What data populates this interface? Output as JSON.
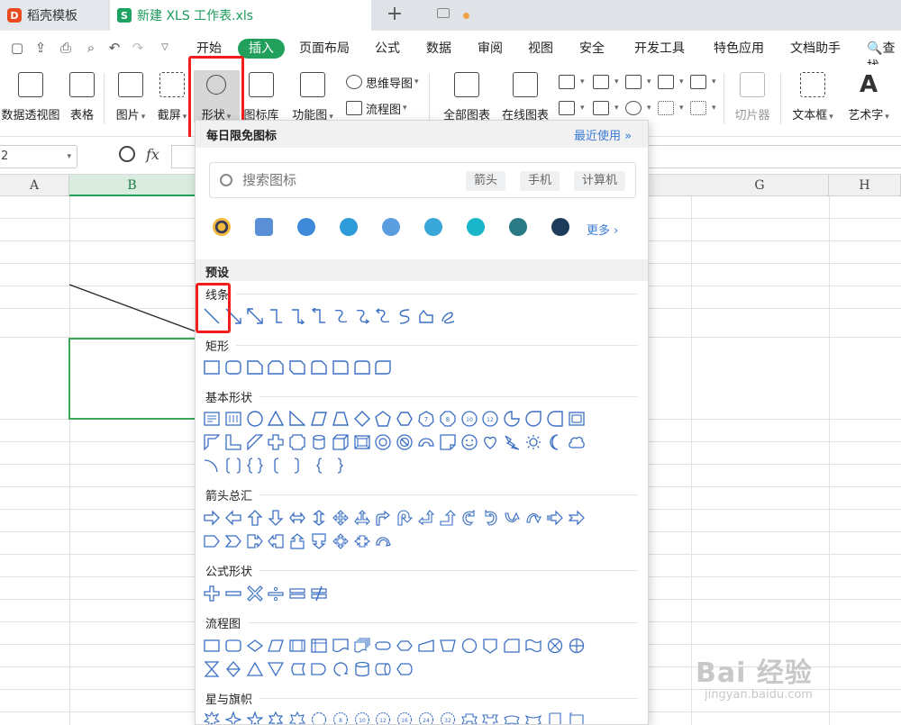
{
  "tabs": [
    {
      "title": "稻壳模板"
    },
    {
      "title": "新建 XLS 工作表.xls"
    }
  ],
  "menu": {
    "items": [
      "开始",
      "插入",
      "页面布局",
      "公式",
      "数据",
      "审阅",
      "视图",
      "安全",
      "开发工具",
      "特色应用",
      "文档助手"
    ],
    "active": "插入",
    "search_label": "查找"
  },
  "ribbon": {
    "pivot": "数据透视图",
    "table": "表格",
    "picture": "图片",
    "screenshot": "截屏",
    "shapes": "形状",
    "icons": "图标库",
    "function_chart": "功能图",
    "mindmap": "思维导图",
    "flowchart": "流程图",
    "all_charts": "全部图表",
    "online_charts": "在线图表",
    "slicer": "切片器",
    "textbox": "文本框",
    "wordart": "艺术字"
  },
  "formula_bar": {
    "name_box": "2",
    "fx": "fx"
  },
  "columns": [
    "A",
    "B",
    "G",
    "H"
  ],
  "panel": {
    "title": "每日限免图标",
    "recent": "最近使用",
    "search_placeholder": "搜索图标",
    "chips": [
      "箭头",
      "手机",
      "计算机"
    ],
    "more": "更多",
    "preset": "预设",
    "categories": [
      "线条",
      "矩形",
      "基本形状",
      "箭头总汇",
      "公式形状",
      "流程图",
      "星与旗帜"
    ]
  },
  "watermark": {
    "text": "Bai 经验",
    "url": "jingyan.baidu.com"
  },
  "colors": {
    "accent": "#20a05b",
    "highlight": "#f21d1d",
    "link": "#3a7bd5",
    "shape_stroke": "#3a6fc4"
  }
}
